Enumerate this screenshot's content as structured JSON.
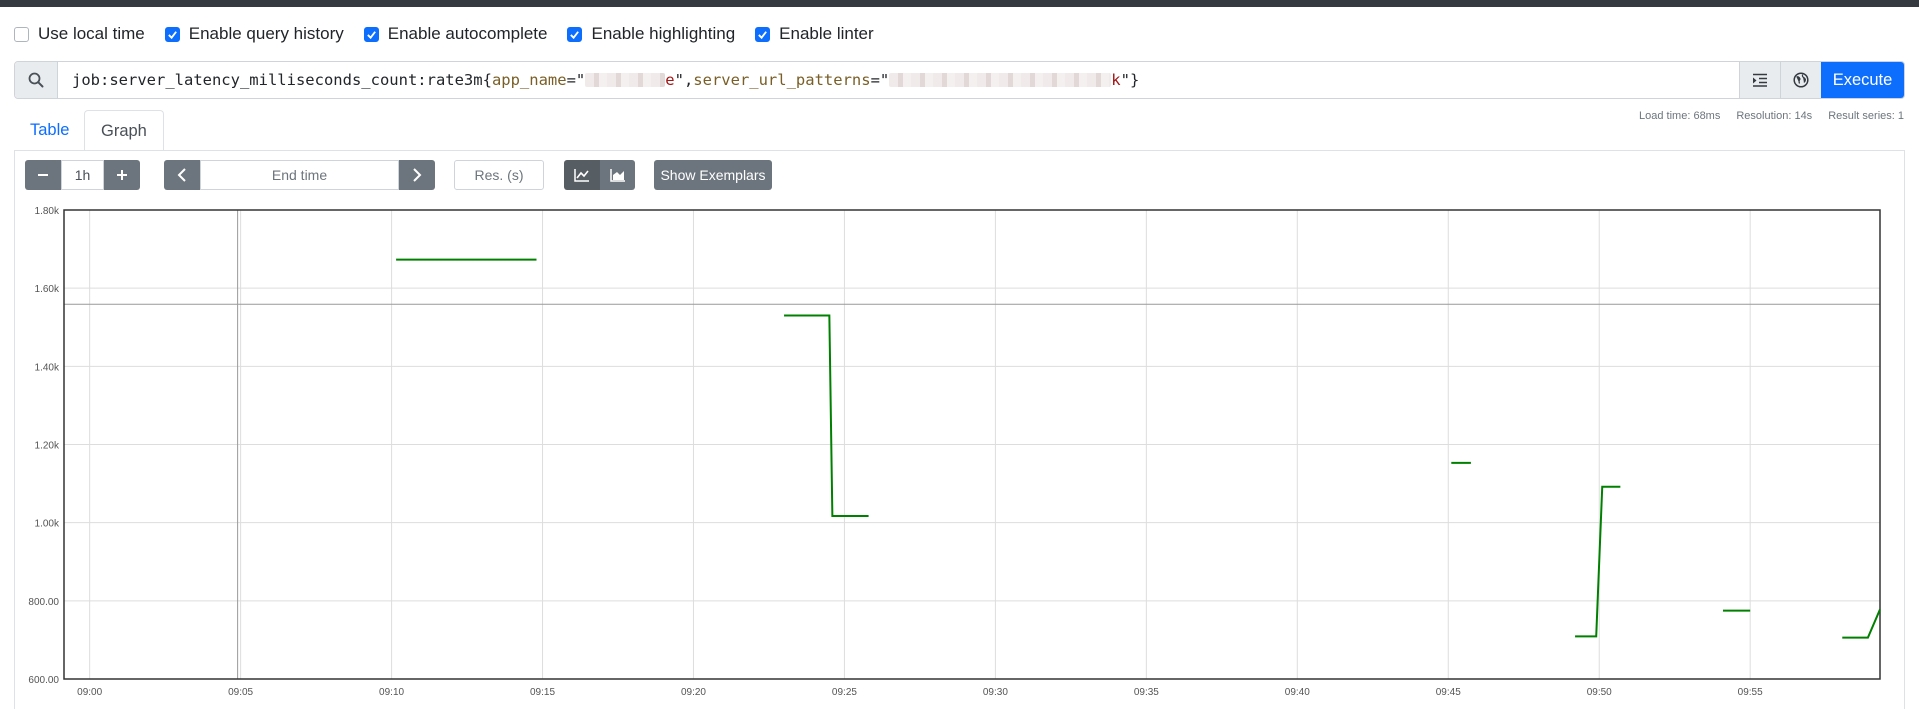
{
  "options": [
    {
      "label": "Use local time",
      "checked": false
    },
    {
      "label": "Enable query history",
      "checked": true
    },
    {
      "label": "Enable autocomplete",
      "checked": true
    },
    {
      "label": "Enable highlighting",
      "checked": true
    },
    {
      "label": "Enable linter",
      "checked": true
    }
  ],
  "query": {
    "metric": "job:server_latency_milliseconds_count:rate3m{",
    "label1": "app_name",
    "eq_quote": "=\"",
    "label1_visible_tail": "e",
    "sep": "\",",
    "label2": "server_url_patterns",
    "label2_visible_tail": "k",
    "close": "\"}",
    "execute_label": "Execute",
    "search_icon": "search-icon",
    "format_icon": "format-indent-icon",
    "explorer_icon": "globe-icon"
  },
  "tabs": [
    {
      "label": "Table",
      "active": false
    },
    {
      "label": "Graph",
      "active": true
    }
  ],
  "stats": {
    "load_time": "Load time: 68ms",
    "resolution": "Resolution: 14s",
    "result_series": "Result series: 1"
  },
  "graph_controls": {
    "range": "1h",
    "minus_icon": "minus-icon",
    "plus_icon": "plus-icon",
    "end_time_placeholder": "End time",
    "prev_icon": "chevron-left-icon",
    "next_icon": "chevron-right-icon",
    "resolution_placeholder": "Res. (s)",
    "line_icon": "line-chart-icon",
    "stacked_icon": "area-chart-icon",
    "show_exemplars": "Show Exemplars"
  },
  "chart_data": {
    "type": "line",
    "ylim": [
      600,
      1800
    ],
    "yticks": [
      "600.00",
      "800.00",
      "1.00k",
      "1.20k",
      "1.40k",
      "1.60k",
      "1.80k"
    ],
    "xticks": [
      "09:00",
      "09:05",
      "09:10",
      "09:15",
      "09:20",
      "09:25",
      "09:30",
      "09:35",
      "09:40",
      "09:45",
      "09:50",
      "09:55"
    ],
    "xlim_minutes_after_0900": [
      -0.85,
      59.3
    ],
    "grid": true,
    "legend": "none",
    "series_color": "#008000",
    "crosshair": {
      "x": "09:05",
      "y": 1559
    },
    "series": [
      {
        "segments": [
          [
            [
              10.15,
              1673
            ],
            [
              14.8,
              1673
            ]
          ],
          [
            [
              23.0,
              1530
            ],
            [
              24.5,
              1530
            ],
            [
              24.6,
              1017
            ],
            [
              25.8,
              1017
            ]
          ],
          [
            [
              45.1,
              1153
            ],
            [
              45.75,
              1153
            ]
          ],
          [
            [
              49.2,
              709
            ],
            [
              49.9,
              709
            ],
            [
              50.1,
              1092
            ],
            [
              50.7,
              1092
            ]
          ],
          [
            [
              54.1,
              775
            ],
            [
              55.0,
              775
            ]
          ],
          [
            [
              58.05,
              706
            ],
            [
              58.9,
              706
            ],
            [
              59.3,
              778
            ]
          ]
        ]
      }
    ]
  }
}
